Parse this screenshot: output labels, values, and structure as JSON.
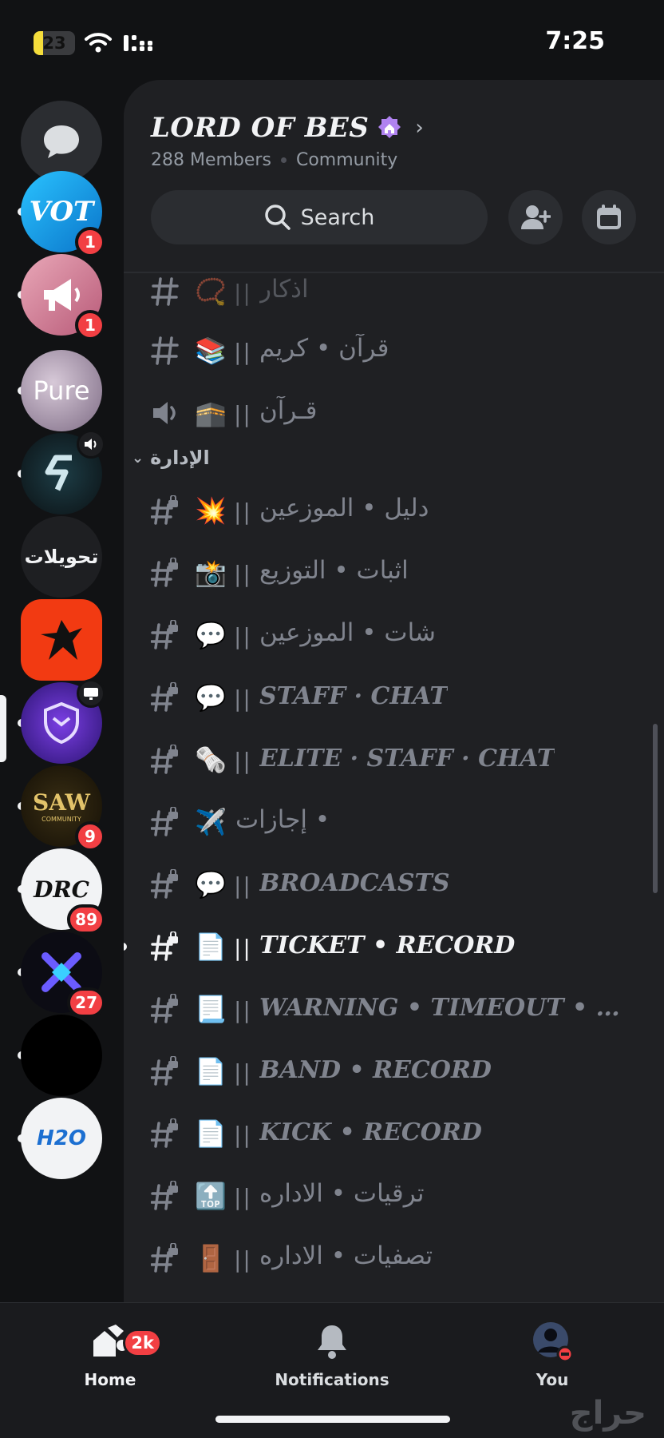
{
  "status_bar": {
    "battery": "23",
    "battery_level": 0.23,
    "time": "7:25"
  },
  "server_rail": {
    "items": [
      {
        "kind": "dm",
        "icon": "chat-bubble-icon"
      },
      {
        "label": "VOT",
        "badge": "1",
        "unread": true
      },
      {
        "icon": "megaphone-icon",
        "badge": "1",
        "unread": true
      },
      {
        "label": "Pure",
        "unread": true
      },
      {
        "icon": "voice-speaker-icon",
        "unread": true
      },
      {
        "label": "تحويلات"
      },
      {
        "icon": "eagle-icon",
        "active": true
      },
      {
        "icon": "screen-share-icon",
        "unread": true
      },
      {
        "label": "SAW",
        "sublabel": "COMMUNITY",
        "badge": "9",
        "unread": true
      },
      {
        "label": "DRC",
        "badge": "89",
        "unread": true
      },
      {
        "icon": "x-logo-icon",
        "badge": "27",
        "unread": true
      },
      {
        "icon": "blank",
        "unread": true
      },
      {
        "label": "H2O",
        "unread": true
      }
    ]
  },
  "server": {
    "name": "LORD OF BES",
    "members": "288 Members",
    "type": "Community",
    "search_label": "Search"
  },
  "category": {
    "name": "الإدارة"
  },
  "channels": [
    {
      "name": "اذكار",
      "emoji": "📿",
      "bars": "||",
      "hash": "text",
      "dim": true
    },
    {
      "name": "قرآن • كريم",
      "emoji": "📚",
      "bars": "||",
      "hash": "text"
    },
    {
      "name": "قـرآن",
      "emoji": "🕋",
      "bars": "||",
      "hash": "voice"
    },
    {
      "name": "دليل • الموزعين",
      "emoji": "💥",
      "bars": "||",
      "hash": "locked"
    },
    {
      "name": "اثبات • التوزيع",
      "emoji": "📸",
      "bars": "||",
      "hash": "locked"
    },
    {
      "name": "شات • الموزعين",
      "emoji": "💬",
      "bars": "||",
      "hash": "locked"
    },
    {
      "name": "STAFF · CHAT",
      "emoji": "💬",
      "bars": "||",
      "hash": "locked",
      "latin": true
    },
    {
      "name": "ELITE · STAFF · CHAT",
      "emoji": "🗞️",
      "bars": "||",
      "hash": "locked",
      "latin": true
    },
    {
      "name": "إجازات •",
      "emoji": "✈️",
      "bars": "",
      "hash": "locked"
    },
    {
      "name": "BROADCASTS",
      "emoji": "💬",
      "bars": "||",
      "hash": "locked",
      "latin": true
    },
    {
      "name": "TICKET • RECORD",
      "emoji": "📄",
      "bars": "||",
      "hash": "locked",
      "latin": true,
      "active": true,
      "unread": true
    },
    {
      "name": "WARNING • TIMEOUT • RE...",
      "emoji": "📃",
      "bars": "||",
      "hash": "locked",
      "latin": true
    },
    {
      "name": "BAND • RECORD",
      "emoji": "📄",
      "bars": "||",
      "hash": "locked",
      "latin": true
    },
    {
      "name": "KICK • RECORD",
      "emoji": "📄",
      "bars": "||",
      "hash": "locked",
      "latin": true
    },
    {
      "name": "ترقيات • الاداره",
      "emoji": "🔝",
      "bars": "||",
      "hash": "locked"
    },
    {
      "name": "تصفيات • الاداره",
      "emoji": "🚪",
      "bars": "||",
      "hash": "locked"
    }
  ],
  "tabs": {
    "home": {
      "label": "Home",
      "badge": "2k"
    },
    "notifications": {
      "label": "Notifications"
    },
    "you": {
      "label": "You"
    }
  },
  "watermark": "حراج",
  "colors": {
    "badge": "#f23f43",
    "background": "#111214",
    "panel": "#1f2023"
  }
}
